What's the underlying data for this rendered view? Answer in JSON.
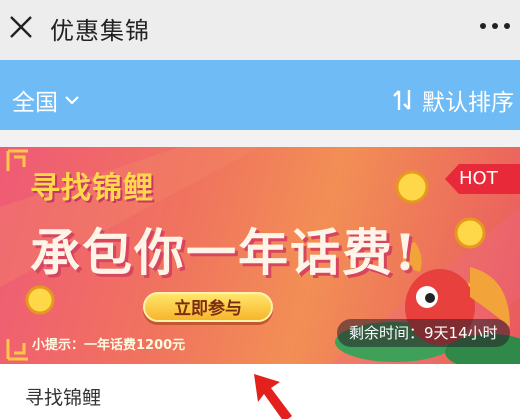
{
  "header": {
    "title": "优惠集锦",
    "close_icon": "close-icon",
    "more_icon": "more-icon"
  },
  "filter_bar": {
    "background": "#6ebbf5",
    "region_label": "全国",
    "sort_label": "默认排序",
    "sort_icon": "sort-icon"
  },
  "promo_card": {
    "banner": {
      "brand": "寻找锦鲤",
      "headline": "承包你一年话费!",
      "hot_badge": "HOT",
      "join_button": "立即参与",
      "tip": "小提示：一年话费1200元",
      "countdown": "剩余时间：9天14小时"
    },
    "title": "寻找锦鲤"
  },
  "colors": {
    "hot_badge": "#e8293a",
    "join_button": "#f7c23a",
    "cursor": "#e3201b"
  }
}
